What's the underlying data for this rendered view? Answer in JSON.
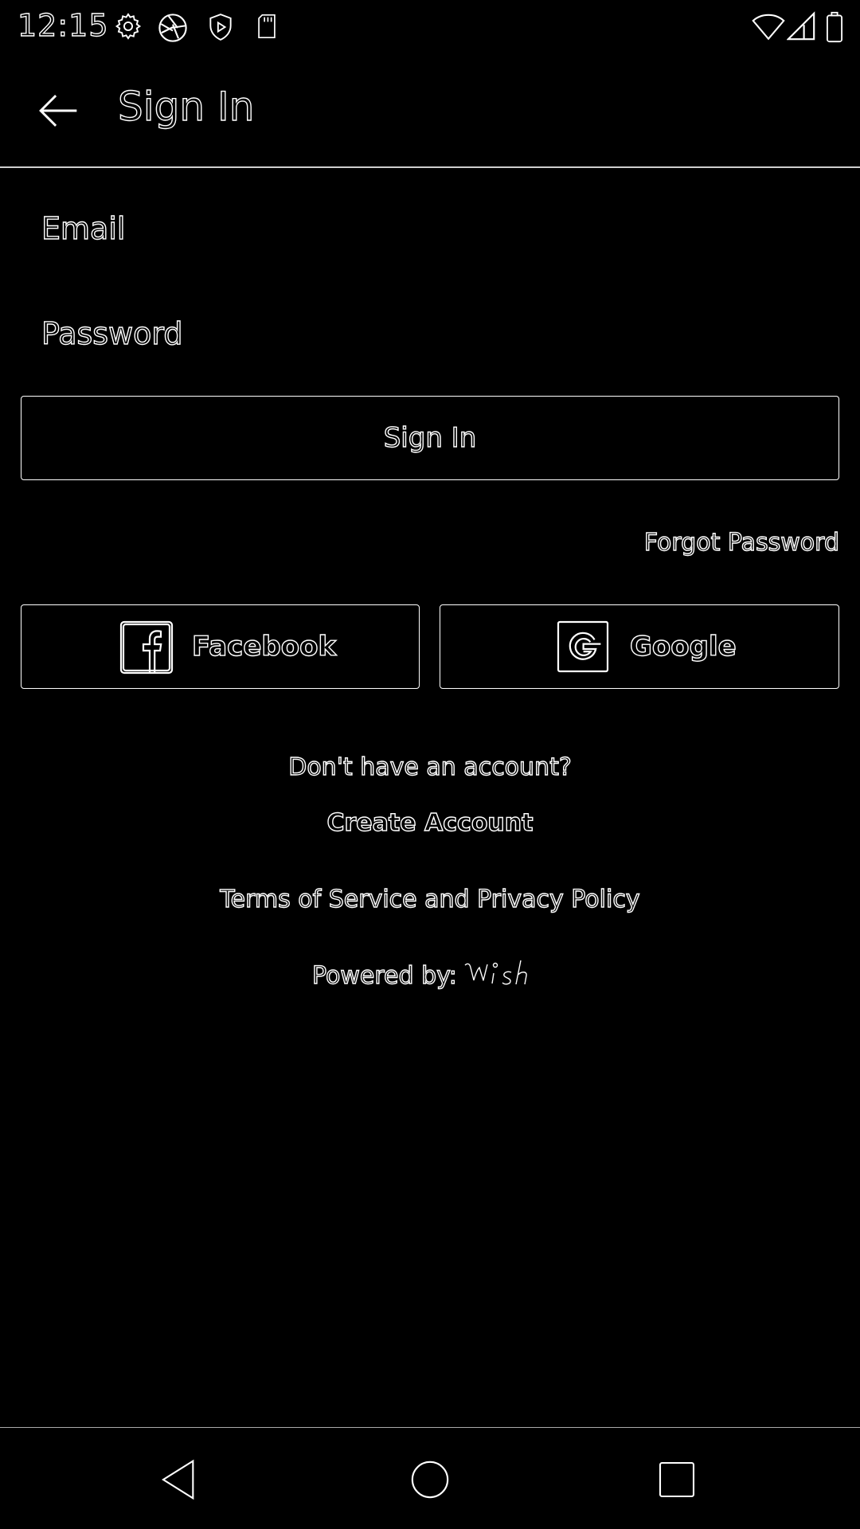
{
  "status_bar": {
    "time": "12:15",
    "left_icons": [
      "gear-icon",
      "camera-aperture-icon",
      "shield-play-icon",
      "sd-card-icon"
    ],
    "right_icons": [
      "wifi-icon",
      "cell-signal-icon",
      "battery-icon"
    ]
  },
  "app_bar": {
    "back_icon": "arrow-left-icon",
    "title": "Sign In"
  },
  "form": {
    "email_label": "Email",
    "email_value": "",
    "password_label": "Password",
    "password_value": ""
  },
  "buttons": {
    "sign_in": "Sign In",
    "forgot_password": "Forgot Password",
    "facebook": "Facebook",
    "google": "Google"
  },
  "footer": {
    "no_account_prompt": "Don't have an account?",
    "create_account": "Create Account",
    "terms": "Terms of Service and Privacy Policy",
    "powered_by": "Powered by:",
    "brand_logo": "wish"
  },
  "nav_bar": {
    "icons": [
      "back-triangle-icon",
      "home-circle-icon",
      "recents-square-icon"
    ]
  },
  "colors": {
    "background": "#000000",
    "outline": "#ffffff",
    "divider": "#cfcfcf"
  }
}
